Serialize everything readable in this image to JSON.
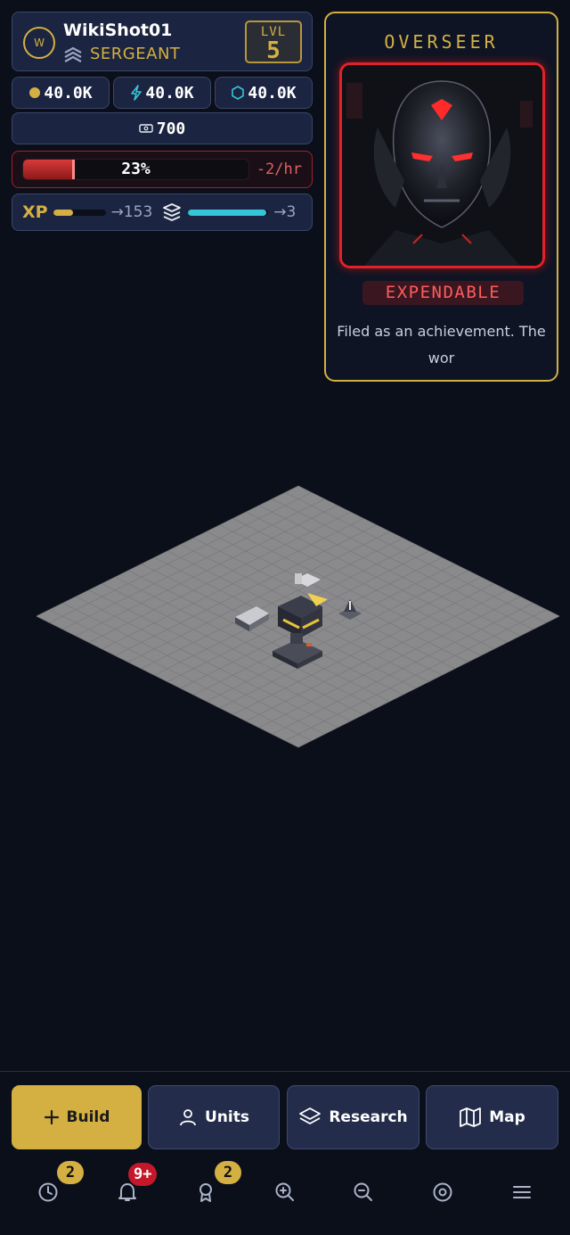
{
  "player": {
    "avatar_initial": "W",
    "name": "WikiShot01",
    "rank": "SERGEANT",
    "level_label": "LVL",
    "level": "5"
  },
  "resources": {
    "gold": "40.0K",
    "energy": "40.0K",
    "crystal": "40.0K",
    "tickets": "700"
  },
  "morale": {
    "percent_text": "23%",
    "percent": 23,
    "rate": "-2/hr"
  },
  "progress": {
    "xp_label": "XP",
    "xp_fraction": 0.38,
    "xp_next": "→153",
    "rank_fraction": 0.98,
    "rank_next": "→3"
  },
  "overseer": {
    "title": "OVERSEER",
    "status": "EXPENDABLE",
    "description": "Filed as an achievement. The wor"
  },
  "actions": {
    "build": "Build",
    "units": "Units",
    "research": "Research",
    "map": "Map"
  },
  "nav": {
    "history_badge": "2",
    "notifications_badge": "9+",
    "achievements_badge": "2"
  },
  "colors": {
    "accent": "#d4b043",
    "danger": "#e0222a",
    "panel": "#1b2440",
    "background": "#0b0f1a",
    "cyan": "#36c5d8"
  }
}
